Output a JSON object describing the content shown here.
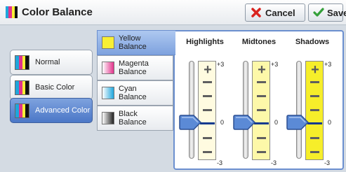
{
  "header": {
    "title": "Color Balance",
    "cancel_label": "Cancel",
    "save_label": "Save",
    "cancel_icon": "x-icon",
    "save_icon": "check-icon",
    "title_icon": "color-bars-icon"
  },
  "categories": [
    {
      "label": "Normal",
      "selected": false
    },
    {
      "label": "Basic Color",
      "selected": false
    },
    {
      "label": "Advanced Color",
      "selected": true
    }
  ],
  "tabs": [
    {
      "line1": "Yellow",
      "line2": "Balance",
      "swatch": "#f7ef35",
      "selected": true
    },
    {
      "line1": "Magenta",
      "line2": "Balance",
      "swatch": "#e2338c",
      "selected": false
    },
    {
      "line1": "Cyan",
      "line2": "Balance",
      "swatch": "#1fa6dc",
      "selected": false
    },
    {
      "line1": "Black",
      "line2": "Balance",
      "swatch": "#222222",
      "selected": false
    }
  ],
  "sliders": [
    {
      "label": "Highlights",
      "max_label": "+3",
      "mid_label": "0",
      "min_label": "-3",
      "value": 0,
      "fill": "#fffbe0"
    },
    {
      "label": "Midtones",
      "max_label": "+3",
      "mid_label": "0",
      "min_label": "-3",
      "value": 0,
      "fill": "#fdf8a9"
    },
    {
      "label": "Shadows",
      "max_label": "+3",
      "mid_label": "0",
      "min_label": "-3",
      "value": 0,
      "fill": "#f6ee2a"
    }
  ],
  "colors": {
    "accent": "#4b77c7",
    "cancel_red": "#d9231e",
    "save_green": "#35a03a"
  }
}
